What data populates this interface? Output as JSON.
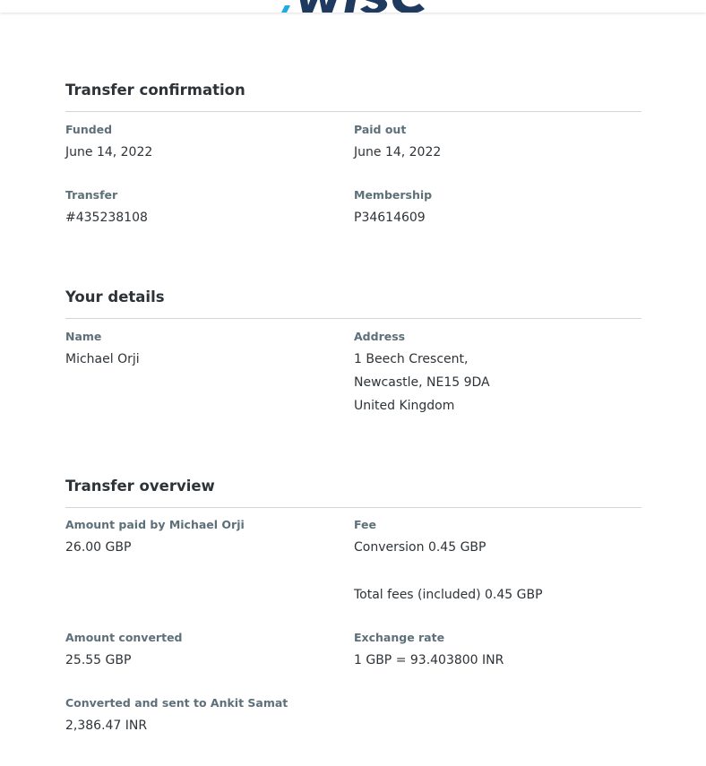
{
  "brand": {
    "logo_color_dark": "#1f3a5f",
    "logo_color_accent": "#23a9e1"
  },
  "colors": {
    "label": "#5d7079",
    "text": "#2e3338",
    "divider": "#d2d6da"
  },
  "transfer_confirmation": {
    "title": "Transfer confirmation",
    "funded_label": "Funded",
    "funded_value": "June 14, 2022",
    "paid_out_label": "Paid out",
    "paid_out_value": "June 14, 2022",
    "transfer_label": "Transfer",
    "transfer_value": "#435238108",
    "membership_label": "Membership",
    "membership_value": "P34614609"
  },
  "your_details": {
    "title": "Your details",
    "name_label": "Name",
    "name_value": "Michael Orji",
    "address_label": "Address",
    "address_lines": [
      "1 Beech Crescent,",
      "Newcastle, NE15 9DA",
      "United Kingdom"
    ]
  },
  "transfer_overview": {
    "title": "Transfer overview",
    "amount_paid_label": "Amount paid by Michael Orji",
    "amount_paid_value": "26.00 GBP",
    "fee_label": "Fee",
    "fee_conversion": "Conversion 0.45 GBP",
    "fee_total": "Total fees (included) 0.45 GBP",
    "amount_converted_label": "Amount converted",
    "amount_converted_value": "25.55 GBP",
    "exchange_rate_label": "Exchange rate",
    "exchange_rate_value": "1 GBP = 93.403800 INR",
    "converted_sent_label": "Converted and sent to Ankit Samat",
    "converted_sent_value": "2,386.47 INR"
  }
}
